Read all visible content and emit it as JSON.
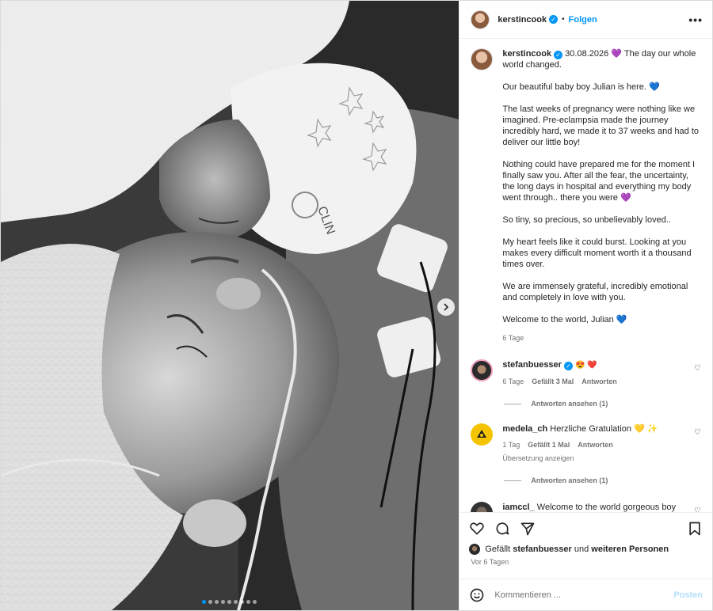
{
  "post": {
    "username": "kerstincook",
    "follow_label": "Folgen",
    "more_label": "•••",
    "caption": {
      "username": "kerstincook",
      "date": "30.08.2026",
      "heart": "💜",
      "paragraphs": [
        "The day our whole world changed.",
        "Our beautiful baby boy Julian is here. 💙",
        "The last weeks of pregnancy were nothing like we imagined. Pre-eclampsia made the journey incredibly hard, we made it to 37 weeks and had to deliver our little boy!",
        "Nothing could have prepared me for the moment I finally saw you. After all the fear, the uncertainty, the long days in hospital and everything my body went through.. there you were 💜",
        "So tiny, so precious, so unbelievably loved..",
        "My heart feels like it could burst. Looking at you makes every difficult moment worth it a thousand times over.",
        "We are immensely grateful, incredibly emotional and completely in love with you.",
        "Welcome to the world, Julian 💙"
      ],
      "age": "6 Tage"
    },
    "comments": [
      {
        "username": "stefanbuesser",
        "text": "😍 ❤️",
        "age": "6 Tage",
        "likes": "Gefällt 3 Mal",
        "reply_label": "Antworten",
        "view_replies": "Antworten ansehen (1)"
      },
      {
        "username": "medela_ch",
        "text": "Herzliche Gratulation 💛 ✨",
        "age": "1 Tag",
        "likes": "Gefällt 1 Mal",
        "reply_label": "Antworten",
        "translate": "Übersetzung anzeigen",
        "view_replies": "Antworten ansehen (1)"
      },
      {
        "username": "iamccl_",
        "text": "Welcome to the world gorgeous boy",
        "hearts": "🩵🩵❤️❤️❤️🩵🩵"
      }
    ],
    "liked_by": {
      "prefix": "Gefällt",
      "user": "stefanbuesser",
      "mid": "und",
      "others": "weiteren Personen"
    },
    "posted_ago": "Vor 6 Tagen",
    "comment_placeholder": "Kommentieren ...",
    "post_label": "Posten"
  },
  "photo": {
    "hat_text": "CLIN",
    "carousel_count": 9,
    "carousel_active": 1
  },
  "icons": [
    "heart-icon",
    "comment-icon",
    "share-icon",
    "bookmark-icon",
    "emoji-icon",
    "chevron-right-icon",
    "verified-icon",
    "more-options-icon"
  ]
}
